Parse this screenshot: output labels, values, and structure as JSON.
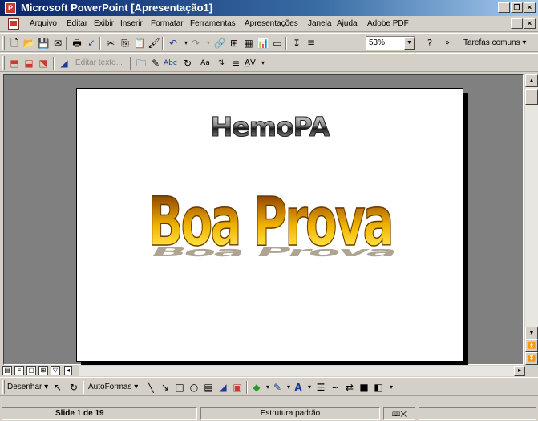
{
  "window": {
    "title": "Microsoft PowerPoint [Apresentação1]",
    "app_icon": "powerpoint-icon",
    "controls": [
      "minimize-icon",
      "restore-icon",
      "close-icon"
    ]
  },
  "menubar": {
    "items": [
      "Arquivo",
      "Editar",
      "Exibir",
      "Inserir",
      "Formatar",
      "Ferramentas",
      "Apresentações",
      "Janela",
      "Ajuda",
      "Adobe PDF"
    ]
  },
  "standard_toolbar": {
    "zoom": "53%",
    "help_glyph": "?",
    "overflow": "»",
    "tasks_label": "Tarefas comuns ▾"
  },
  "formatting_toolbar": {
    "edit_text_label": "Editar texto..."
  },
  "slide": {
    "title_text": "HemoPA",
    "body_text": "Boa Prova"
  },
  "drawing_toolbar": {
    "draw_menu": "Desenhar ▾",
    "autoshapes_menu": "AutoFormas ▾"
  },
  "statusbar": {
    "slide_position": "Slide 1 de 19",
    "design_template": "Estrutura padrão"
  },
  "colors": {
    "titlebar_start": "#0a246a",
    "titlebar_end": "#a6caf0",
    "chrome": "#d4d0c8",
    "workspace": "#808080",
    "wordart_gold": "#f0b400"
  }
}
